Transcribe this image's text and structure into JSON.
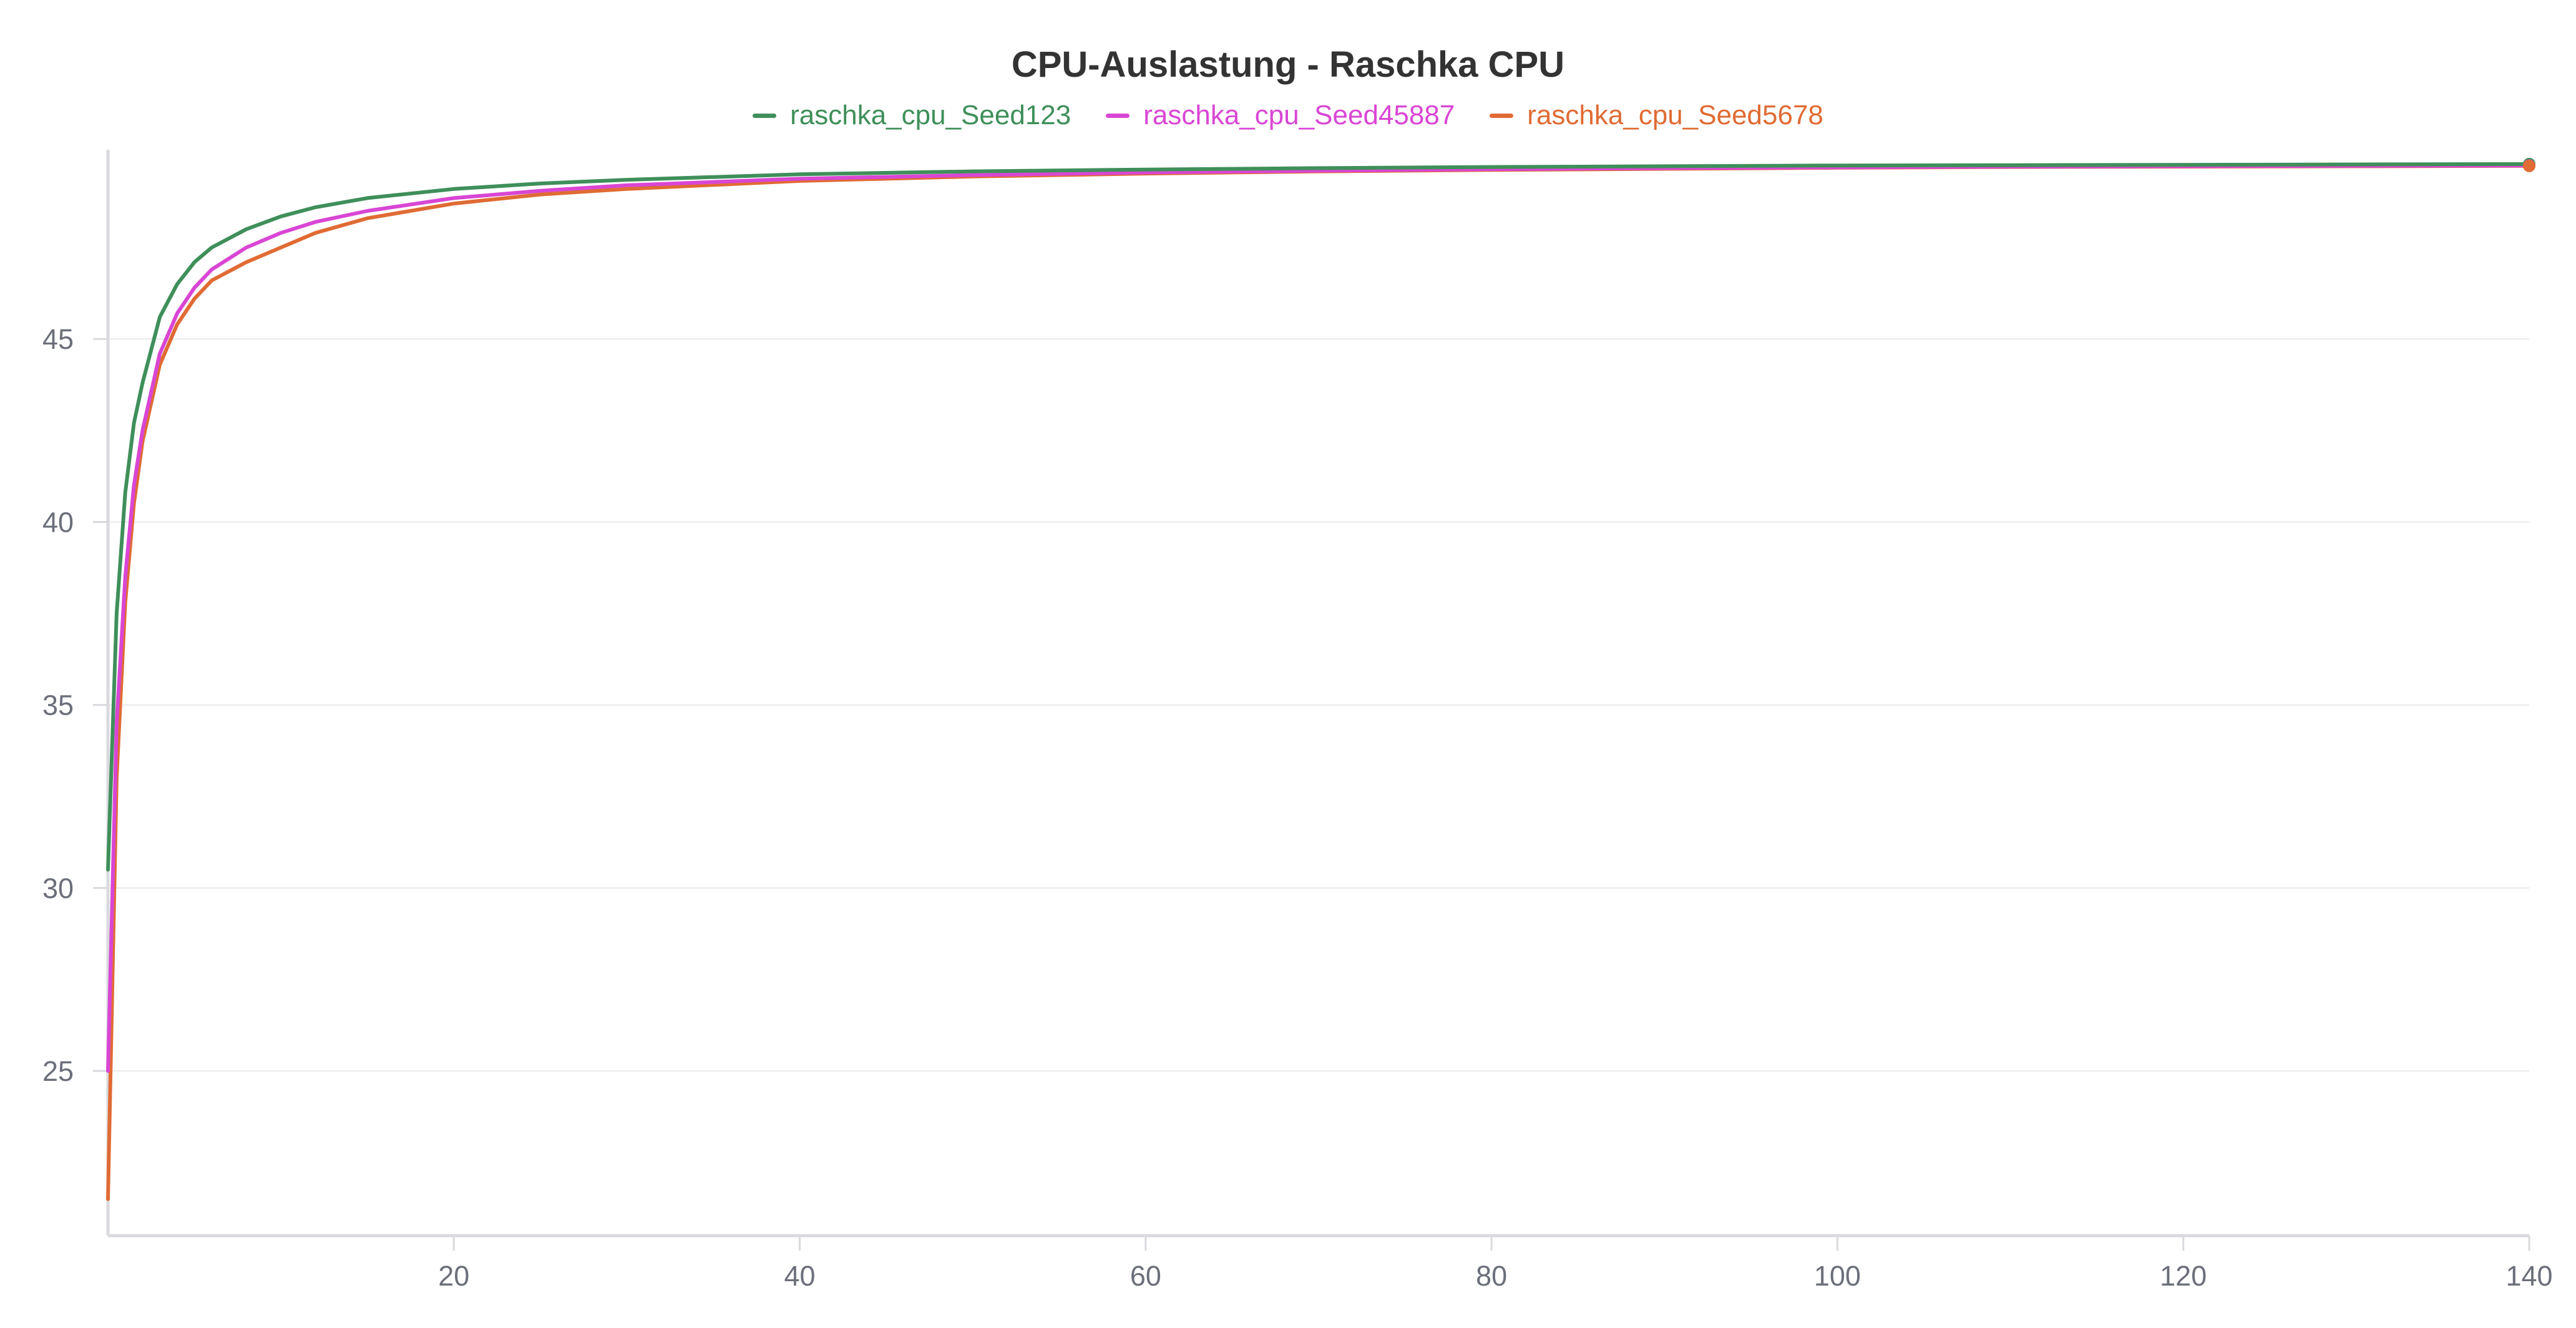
{
  "chart_data": {
    "type": "line",
    "title": "CPU-Auslastung - Raschka CPU",
    "xlabel": "",
    "ylabel": "",
    "xlim": [
      0,
      140
    ],
    "ylim": [
      20.5,
      50
    ],
    "x_ticks": [
      20,
      40,
      60,
      80,
      100,
      120,
      140
    ],
    "y_ticks": [
      25,
      30,
      35,
      40,
      45
    ],
    "grid": "horizontal",
    "legend_position": "top-center",
    "series": [
      {
        "name": "raschka_cpu_Seed123",
        "color": "#3f8f5a",
        "x": [
          0,
          0.5,
          1,
          1.5,
          2,
          3,
          4,
          5,
          6,
          8,
          10,
          12,
          15,
          20,
          25,
          30,
          40,
          50,
          60,
          70,
          80,
          90,
          100,
          110,
          120,
          130,
          140
        ],
        "y": [
          30.5,
          37.5,
          40.8,
          42.7,
          43.8,
          45.6,
          46.5,
          47.1,
          47.5,
          48.0,
          48.35,
          48.6,
          48.85,
          49.1,
          49.25,
          49.35,
          49.5,
          49.58,
          49.63,
          49.67,
          49.7,
          49.72,
          49.74,
          49.75,
          49.76,
          49.77,
          49.78
        ]
      },
      {
        "name": "raschka_cpu_Seed45887",
        "color": "#d946d4",
        "x": [
          0,
          0.5,
          1,
          1.5,
          2,
          3,
          4,
          5,
          6,
          8,
          10,
          12,
          15,
          20,
          25,
          30,
          40,
          50,
          60,
          70,
          80,
          90,
          100,
          110,
          120,
          130,
          140
        ],
        "y": [
          25.0,
          34.5,
          38.5,
          41.0,
          42.5,
          44.6,
          45.7,
          46.4,
          46.9,
          47.5,
          47.9,
          48.2,
          48.5,
          48.85,
          49.05,
          49.2,
          49.38,
          49.48,
          49.55,
          49.6,
          49.64,
          49.67,
          49.69,
          49.71,
          49.72,
          49.73,
          49.74
        ]
      },
      {
        "name": "raschka_cpu_Seed5678",
        "color": "#e06b34",
        "x": [
          0,
          0.5,
          1,
          1.5,
          2,
          3,
          4,
          5,
          6,
          8,
          10,
          12,
          15,
          20,
          25,
          30,
          40,
          50,
          60,
          70,
          80,
          90,
          100,
          110,
          120,
          130,
          140
        ],
        "y": [
          21.5,
          33.0,
          37.8,
          40.5,
          42.2,
          44.3,
          45.4,
          46.1,
          46.6,
          47.1,
          47.5,
          47.9,
          48.3,
          48.7,
          48.95,
          49.1,
          49.32,
          49.44,
          49.52,
          49.58,
          49.62,
          49.65,
          49.68,
          49.7,
          49.71,
          49.72,
          49.73
        ]
      }
    ]
  }
}
